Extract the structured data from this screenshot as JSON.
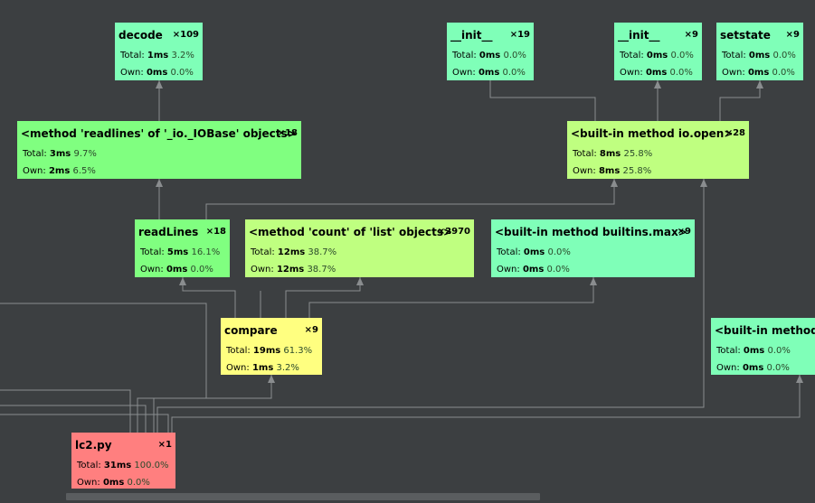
{
  "colors": {
    "background": "#3c3f41",
    "edge": "#8a8d8f",
    "low": "#7fffb8",
    "mid": "#80ff80",
    "warm": "#bfff80",
    "hot": "#ffff80",
    "root": "#ff7f7f"
  },
  "nodes": {
    "decode": {
      "title": "decode",
      "count": "×109",
      "total_label": "Total:",
      "total_time": "1ms",
      "total_pct": "3.2%",
      "own_label": "Own:",
      "own_time": "0ms",
      "own_pct": "0.0%"
    },
    "init1": {
      "title": "__init__",
      "count": "×19",
      "total_label": "Total:",
      "total_time": "0ms",
      "total_pct": "0.0%",
      "own_label": "Own:",
      "own_time": "0ms",
      "own_pct": "0.0%"
    },
    "init2": {
      "title": "__init__",
      "count": "×9",
      "total_label": "Total:",
      "total_time": "0ms",
      "total_pct": "0.0%",
      "own_label": "Own:",
      "own_time": "0ms",
      "own_pct": "0.0%"
    },
    "setstate": {
      "title": "setstate",
      "count": "×9",
      "total_label": "Total:",
      "total_time": "0ms",
      "total_pct": "0.0%",
      "own_label": "Own:",
      "own_time": "0ms",
      "own_pct": "0.0%"
    },
    "readlines_method": {
      "title": "<method 'readlines' of '_io._IOBase' objects>",
      "count": "×18",
      "total_label": "Total:",
      "total_time": "3ms",
      "total_pct": "9.7%",
      "own_label": "Own:",
      "own_time": "2ms",
      "own_pct": "6.5%"
    },
    "io_open": {
      "title": "<built-in method io.open>",
      "count": "×28",
      "total_label": "Total:",
      "total_time": "8ms",
      "total_pct": "25.8%",
      "own_label": "Own:",
      "own_time": "8ms",
      "own_pct": "25.8%"
    },
    "readLines": {
      "title": "readLines",
      "count": "×18",
      "total_label": "Total:",
      "total_time": "5ms",
      "total_pct": "16.1%",
      "own_label": "Own:",
      "own_time": "0ms",
      "own_pct": "0.0%"
    },
    "count_method": {
      "title": "<method 'count' of 'list' objects>",
      "count": "×2970",
      "total_label": "Total:",
      "total_time": "12ms",
      "total_pct": "38.7%",
      "own_label": "Own:",
      "own_time": "12ms",
      "own_pct": "38.7%"
    },
    "builtins_max": {
      "title": "<built-in method builtins.max>",
      "count": "×9",
      "total_label": "Total:",
      "total_time": "0ms",
      "total_pct": "0.0%",
      "own_label": "Own:",
      "own_time": "0ms",
      "own_pct": "0.0%"
    },
    "compare": {
      "title": "compare",
      "count": "×9",
      "total_label": "Total:",
      "total_time": "19ms",
      "total_pct": "61.3%",
      "own_label": "Own:",
      "own_time": "1ms",
      "own_pct": "3.2%"
    },
    "builtin_method": {
      "title": "<built-in method",
      "count": "",
      "total_label": "Total:",
      "total_time": "0ms",
      "total_pct": "0.0%",
      "own_label": "Own:",
      "own_time": "0ms",
      "own_pct": "0.0%"
    },
    "lc2": {
      "title": "lc2.py",
      "count": "×1",
      "total_label": "Total:",
      "total_time": "31ms",
      "total_pct": "100.0%",
      "own_label": "Own:",
      "own_time": "0ms",
      "own_pct": "0.0%"
    }
  }
}
